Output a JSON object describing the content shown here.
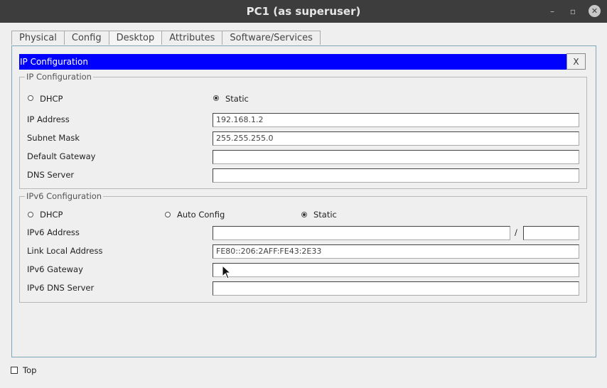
{
  "window": {
    "title": "PC1 (as superuser)",
    "minimize_glyph": "–",
    "maximize_glyph": "▫",
    "close_glyph": "✕"
  },
  "tabs": [
    {
      "label": "Physical"
    },
    {
      "label": "Config"
    },
    {
      "label": "Desktop",
      "active": true
    },
    {
      "label": "Attributes"
    },
    {
      "label": "Software/Services"
    }
  ],
  "ip_window": {
    "title": "IP Configuration",
    "close_label": "X"
  },
  "ipv4": {
    "legend": "IP Configuration",
    "dhcp_label": "DHCP",
    "static_label": "Static",
    "mode": "Static",
    "ip_address_label": "IP Address",
    "ip_address": "192.168.1.2",
    "subnet_mask_label": "Subnet Mask",
    "subnet_mask": "255.255.255.0",
    "gateway_label": "Default Gateway",
    "gateway": "",
    "dns_label": "DNS Server",
    "dns": ""
  },
  "ipv6": {
    "legend": "IPv6 Configuration",
    "dhcp_label": "DHCP",
    "auto_label": "Auto Config",
    "static_label": "Static",
    "mode": "Static",
    "address_label": "IPv6 Address",
    "address": "",
    "prefix_separator": "/",
    "prefix": "",
    "link_local_label": "Link Local Address",
    "link_local": "FE80::206:2AFF:FE43:2E33",
    "gateway_label": "IPv6 Gateway",
    "gateway": "",
    "dns_label": "IPv6 DNS Server",
    "dns": ""
  },
  "footer": {
    "top_label": "Top",
    "top_checked": false
  },
  "colors": {
    "titlebar": "#3d3d3d",
    "ip_header": "#0000ff",
    "pane_border": "#7fa6b8"
  }
}
